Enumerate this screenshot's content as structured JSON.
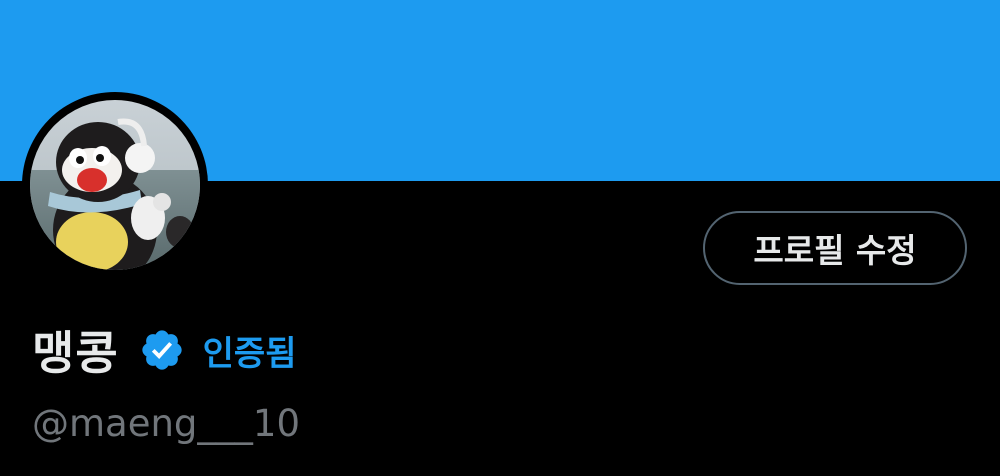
{
  "profile": {
    "display_name": "맹콩",
    "verified_label": "인증됨",
    "handle": "@maeng___10",
    "edit_button_label": "프로필 수정",
    "verified_icon": "verified-badge-icon"
  },
  "colors": {
    "banner": "#1d9bf0",
    "background": "#000000",
    "accent": "#1d9bf0",
    "primary_text": "#e7e9ea",
    "secondary_text": "#71767b",
    "button_border": "#536471"
  }
}
